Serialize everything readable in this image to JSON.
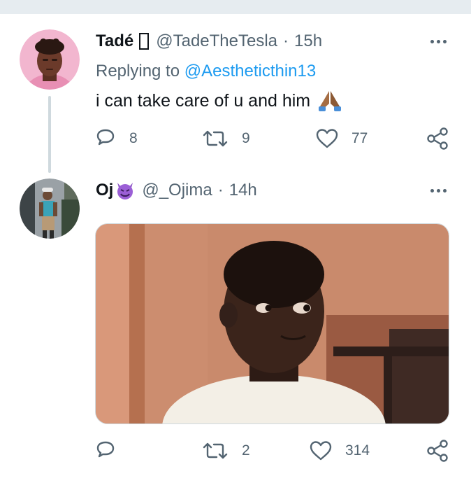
{
  "tweets": [
    {
      "display_name": "Tadé",
      "name_glyph": "missing-glyph",
      "handle": "@TadeTheTesla",
      "separator": "·",
      "time": "15h",
      "replying_prefix": "Replying to",
      "replying_to": "@Aestheticthin13",
      "text": "i can take care of u and him",
      "text_emoji": "folded-hands-icon",
      "counts": {
        "replies": "8",
        "retweets": "9",
        "likes": "77"
      }
    },
    {
      "display_name": "Oj",
      "name_emoji": "smiling-devil-icon",
      "handle": "@_Ojima",
      "separator": "·",
      "time": "14h",
      "media": "gif-boy-looking-sideways",
      "counts": {
        "replies": "",
        "retweets": "2",
        "likes": "314"
      }
    }
  ],
  "colors": {
    "text": "#0f1419",
    "secondary": "#536471",
    "link": "#1d9bf0",
    "divider": "#cfd9de",
    "background": "#ffffff"
  },
  "icons": [
    "reply-icon",
    "retweet-icon",
    "like-icon",
    "share-icon",
    "more-icon"
  ]
}
